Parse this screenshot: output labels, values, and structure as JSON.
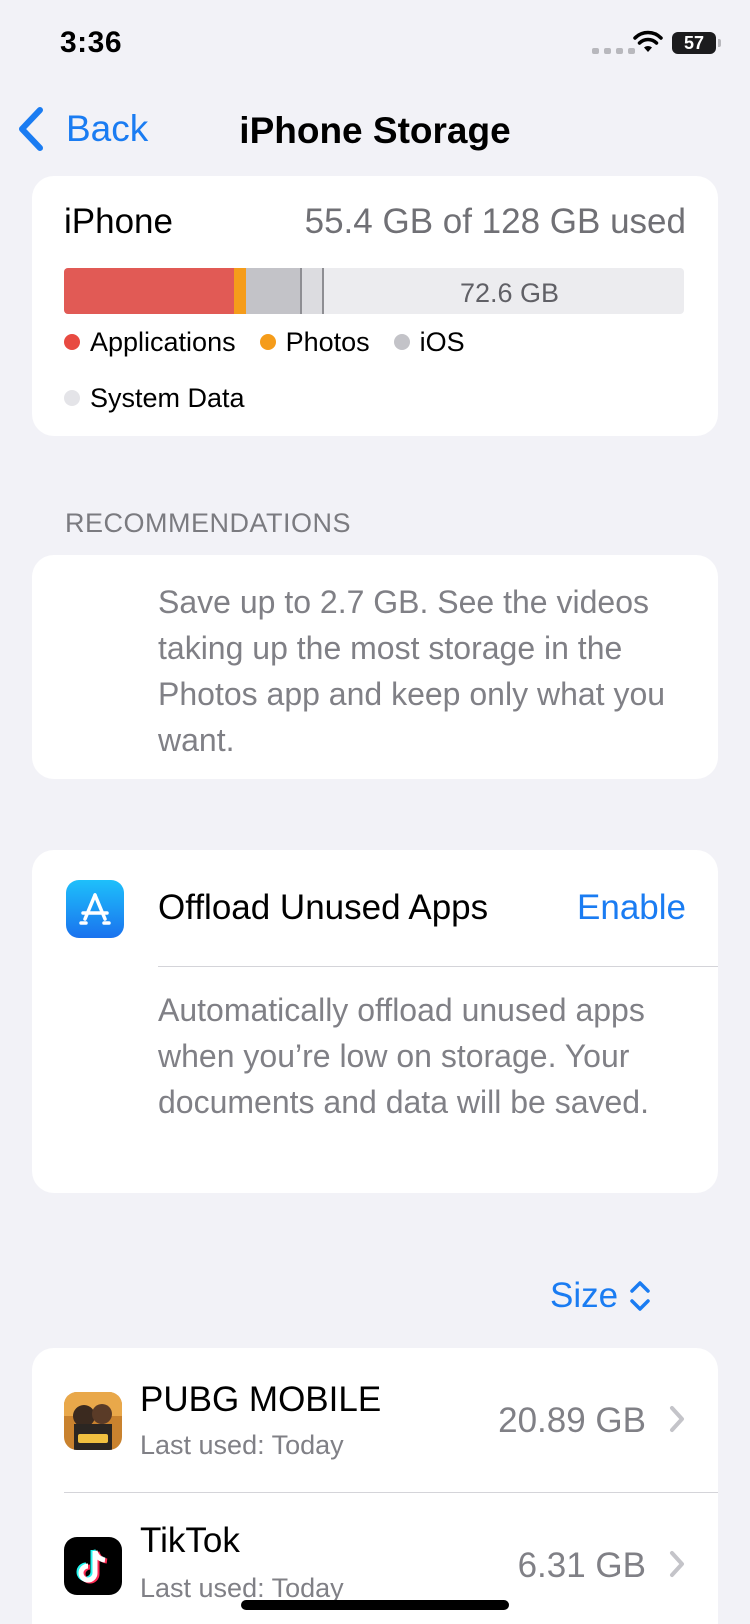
{
  "status_bar": {
    "time": "3:36",
    "battery": "57"
  },
  "nav": {
    "back_label": "Back",
    "title": "iPhone Storage"
  },
  "storage": {
    "device": "iPhone",
    "usage": "55.4 GB of 128 GB used",
    "used_gb": 55.4,
    "total_gb": 128,
    "free_label": "72.6 GB",
    "legend": [
      {
        "label": "Applications",
        "color": "#e84a41"
      },
      {
        "label": "Photos",
        "color": "#f59c1a"
      },
      {
        "label": "iOS",
        "color": "#c3c3c8"
      },
      {
        "label": "System Data",
        "color": "#e4e4e8"
      }
    ]
  },
  "recommendations": {
    "header": "RECOMMENDATIONS",
    "text": "Save up to 2.7 GB. See the videos taking up the most storage in the Photos app and keep only what you want."
  },
  "offload": {
    "icon": "app-store-icon",
    "title": "Offload Unused Apps",
    "action": "Enable",
    "description": "Automatically offload unused apps when you’re low on storage. Your documents and data will be saved."
  },
  "sort": {
    "label": "Size"
  },
  "apps": [
    {
      "name": "PUBG MOBILE",
      "subtitle": "Last used: Today",
      "size": "20.89 GB",
      "icon": "pubg-mobile-icon"
    },
    {
      "name": "TikTok",
      "subtitle": "Last used: Today",
      "size": "6.31 GB",
      "icon": "tiktok-icon"
    }
  ]
}
